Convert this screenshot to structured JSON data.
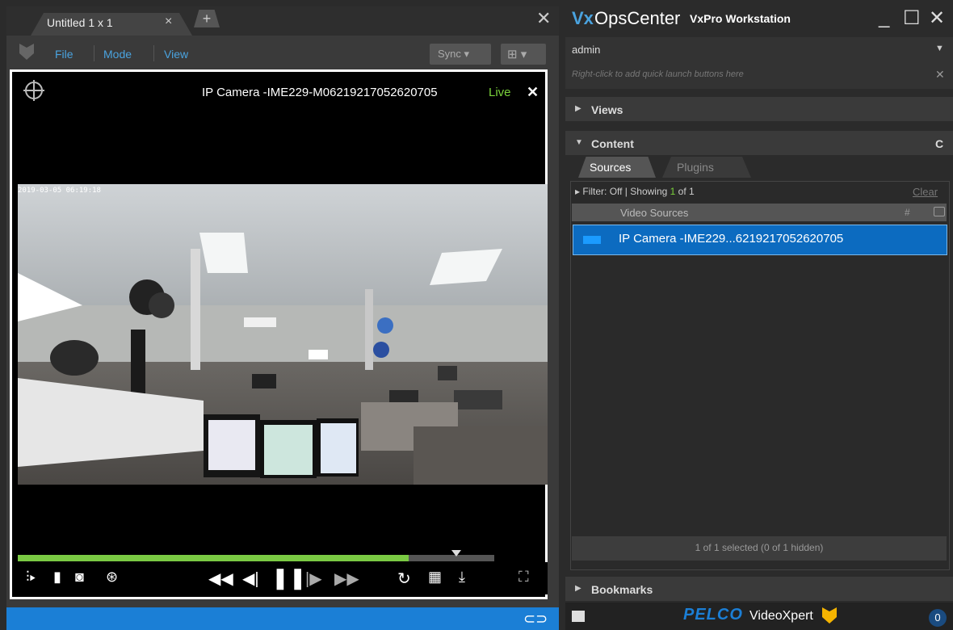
{
  "left": {
    "tab_label": "Untitled 1 x 1",
    "tab_close": "×",
    "tab_add": "+",
    "panel_close": "✕",
    "menu": [
      "File",
      "Mode",
      "View"
    ],
    "sync_label": "Sync ▾",
    "layout_label": "⊞ ▾",
    "camera": {
      "title": "IP Camera -IME229-M06219217052620705",
      "status": "Live",
      "close": "✕",
      "timestamp": "2019-03-05 06:19:18"
    },
    "playback_progress": 0.82,
    "controls": {
      "left": [
        "clip-icon",
        "bookmark-icon",
        "snapshot-icon",
        "search-motion-icon"
      ],
      "center": [
        "rewind-icon",
        "step-back-icon",
        "pause-icon",
        "step-forward-icon",
        "fast-forward-icon"
      ],
      "right": [
        "replay-30-icon",
        "calendar-icon",
        "export-icon"
      ],
      "fullscreen": "fullscreen-icon"
    },
    "status_link_icon": "⊂⊃"
  },
  "right": {
    "brand_vx": "Vx",
    "brand_ops": "OpsCenter",
    "brand_ws": "VxPro Workstation",
    "user": "admin",
    "quick_launch": "Right-click to add quick launch buttons here",
    "views_label": "Views",
    "content_label": "Content",
    "refresh_icon": "C",
    "tabs": [
      "Sources",
      "Plugins"
    ],
    "filter": {
      "prefix": "▸ Filter: Off | Showing ",
      "n": "1",
      "mid": " of ",
      "total": "1"
    },
    "clear_label": "Clear",
    "col_video_sources": "Video Sources",
    "col_hash": "#",
    "rows": [
      {
        "label": "IP Camera -IME229...6219217052620705"
      }
    ],
    "selection_status": "1 of 1 selected (0 of 1 hidden)",
    "bookmarks_label": "Bookmarks",
    "footer": {
      "pelco": "PELCO",
      "videoxpert": "VideoXpert",
      "notifications": "0"
    }
  },
  "colors": {
    "accent": "#1b7fd6",
    "live": "#7ad23b",
    "progress": "#7ac943"
  }
}
